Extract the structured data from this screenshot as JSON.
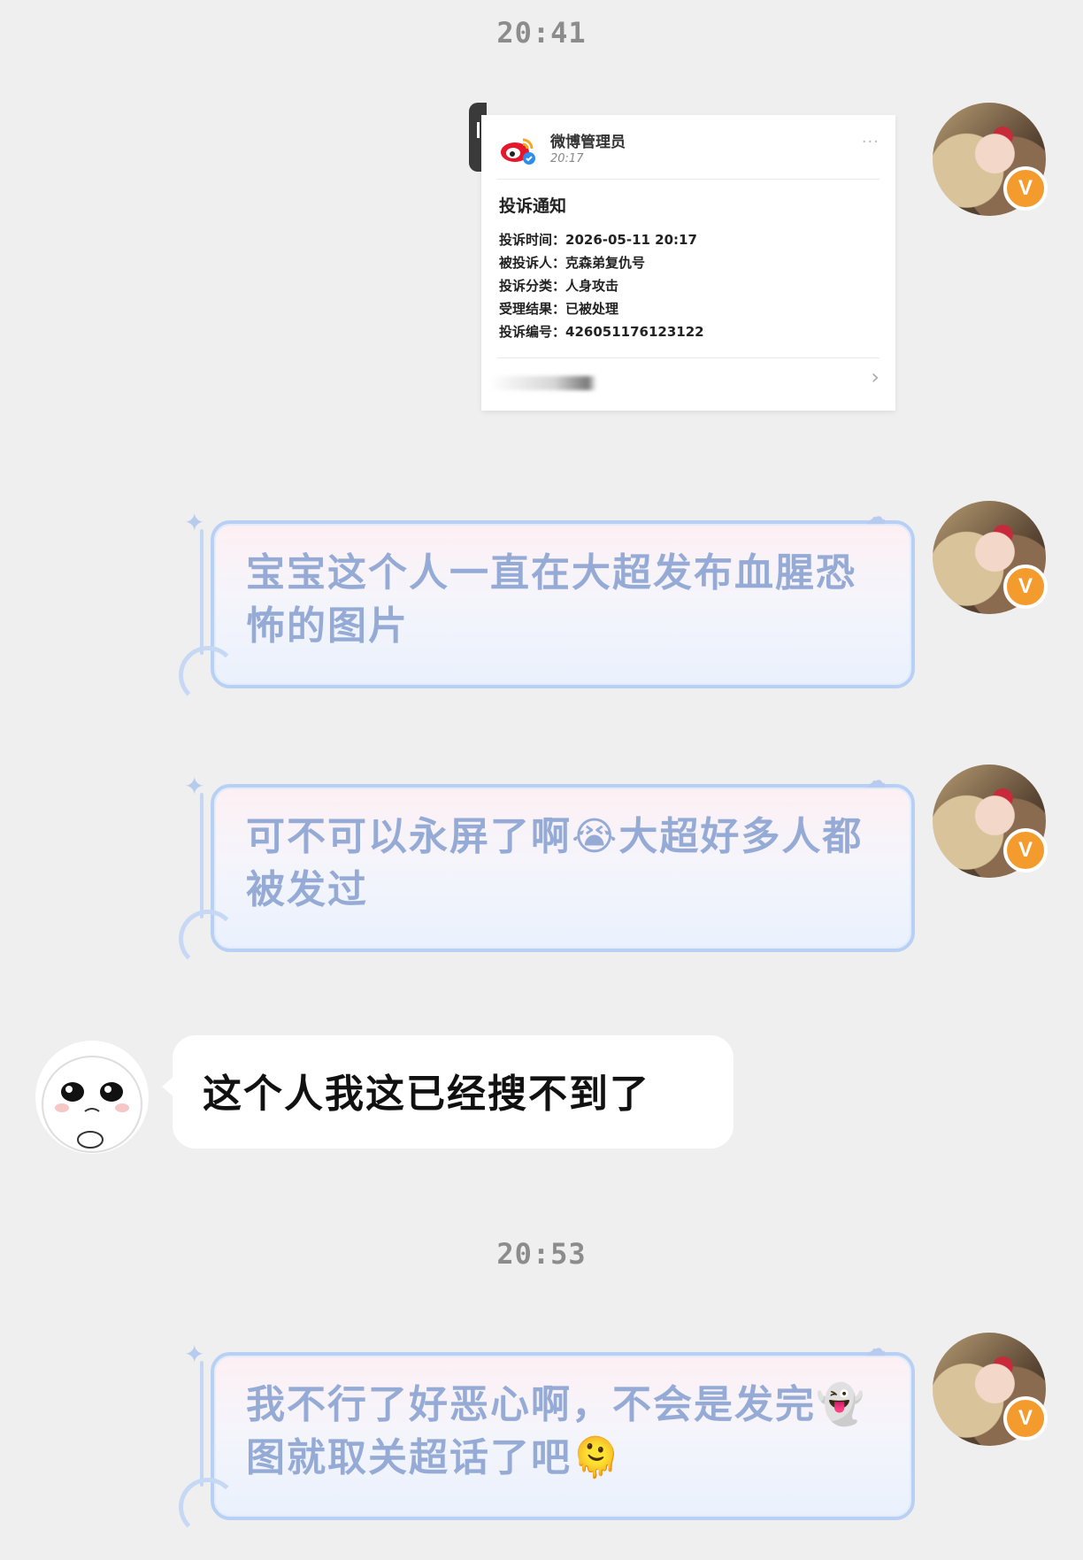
{
  "timestamps": [
    "20:41",
    "20:53"
  ],
  "notice_card": {
    "sender": "微博管理员",
    "time": "20:17",
    "more": "···",
    "title": "投诉通知",
    "rows": [
      {
        "key": "投诉时间：",
        "value": "2026-05-11 20:17"
      },
      {
        "key": "被投诉人：",
        "value": "克森弟复仇号"
      },
      {
        "key": "投诉分类：",
        "value": "人身攻击"
      },
      {
        "key": "受理结果：",
        "value": "已被处理"
      },
      {
        "key": "投诉编号：",
        "value": "426051176123122"
      }
    ],
    "chevron": "›"
  },
  "messages": [
    {
      "side": "right",
      "text": "宝宝这个人一直在大超发布血腥恐怖的图片"
    },
    {
      "side": "right",
      "text_before": "可不可以永屏了啊",
      "emoji": "😭",
      "text_after": "大超好多人都被发过"
    },
    {
      "side": "left",
      "text": "这个人我这已经搜不到了"
    },
    {
      "side": "right",
      "text_before": "我不行了好恶心啊，不会是发完",
      "emoji": "👻",
      "text_mid": "图就取关超话了吧",
      "emoji2": "🫠"
    }
  ],
  "self_avatar": {
    "badge": "V"
  },
  "colors": {
    "bubble_text": "#95abd6",
    "bubble_border": "#b9d0f5",
    "badge": "#f39c2d",
    "background": "#efefef"
  }
}
